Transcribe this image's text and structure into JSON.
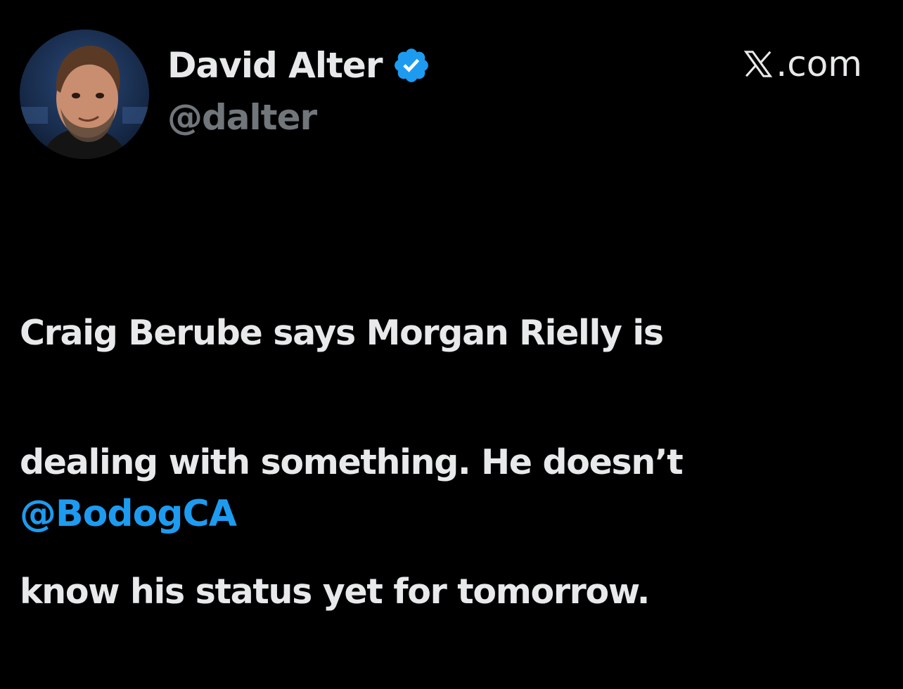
{
  "author": {
    "display_name": "David Alter",
    "handle": "@dalter",
    "verified": true,
    "avatar_icon": "profile-photo"
  },
  "source": {
    "label": ".com",
    "logo_icon": "x-logo-icon"
  },
  "tweet": {
    "text_lines": [
      "Craig Berube says Morgan Rielly is",
      "dealing with something. He doesn’t",
      "know his status yet for tomorrow."
    ],
    "mention": "@BodogCA"
  },
  "colors": {
    "background": "#000000",
    "text": "#e7e9ea",
    "secondary_text": "#71767b",
    "accent": "#1d9bf0",
    "verified_badge": "#1d9bf0"
  }
}
